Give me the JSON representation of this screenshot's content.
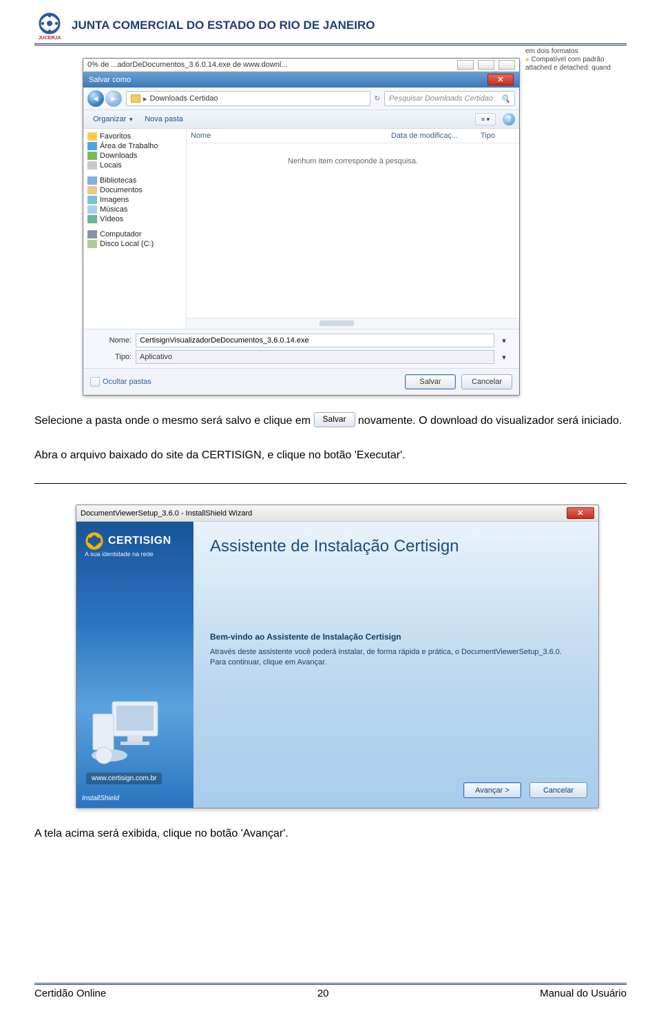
{
  "header": {
    "title": "JUNTA COMERCIAL DO ESTADO DO RIO DE JANEIRO",
    "logo_text": "JUCERJA"
  },
  "context_snippet": {
    "line1": "em dois formatos",
    "line2_prefix": "Compatível com padrão",
    "line3": "attached e detached: quand"
  },
  "dlbar": {
    "text": "0% de ...adorDeDocumentos_3.6.0.14.exe de www.downl..."
  },
  "saveas": {
    "title": "Salvar como",
    "path_label": "Downloads Certidao",
    "search_placeholder": "Pesquisar Downloads Certidao",
    "organize": "Organizar",
    "new_folder": "Nova pasta",
    "columns": {
      "name": "Nome",
      "date": "Data de modificaç...",
      "type": "Tipo"
    },
    "empty": "Nenhum item corresponde à pesquisa.",
    "nav": {
      "favorites": "Favoritos",
      "desktop": "Área de Trabalho",
      "downloads": "Downloads",
      "places": "Locais",
      "libraries": "Bibliotecas",
      "documents": "Documentos",
      "images": "Imagens",
      "music": "Músicas",
      "videos": "Vídeos",
      "computer": "Computador",
      "disk": "Disco Local (C:)"
    },
    "name_label": "Nome:",
    "name_value": "CertisignVisualizadorDeDocumentos_3.6.0.14.exe",
    "type_label": "Tipo:",
    "type_value": "Aplicativo",
    "hide_folders": "Ocultar pastas",
    "save_btn": "Salvar",
    "cancel_btn": "Cancelar"
  },
  "body": {
    "p1a": "Selecione a pasta onde o mesmo será salvo e clique em ",
    "inline_btn": "Salvar",
    "p1b": " novamente. O download do visualizador será iniciado.",
    "p2": "Abra o arquivo baixado do site da CERTISIGN, e clique no botão 'Executar'.",
    "p3": "A tela acima será exibida, clique no botão 'Avançar'."
  },
  "installer": {
    "window_title": "DocumentViewerSetup_3.6.0 - InstallShield Wizard",
    "brand": "CERTISIGN",
    "tagline": "A sua identidade na rede",
    "big_title": "Assistente de Instalação Certisign",
    "welcome_title": "Bem-vindo ao Assistente de Instalação Certisign",
    "welcome_text1": "Através deste assistente você poderá instalar, de forma rápida e prática, o DocumentViewerSetup_3.6.0.",
    "welcome_text2": "Para continuar, clique em Avançar.",
    "url": "www.certisign.com.br",
    "install_shield": "InstallShield",
    "next_btn": "Avançar >",
    "cancel_btn": "Cancelar"
  },
  "footer": {
    "left": "Certidão Online",
    "page": "20",
    "right": "Manual do Usuário"
  }
}
